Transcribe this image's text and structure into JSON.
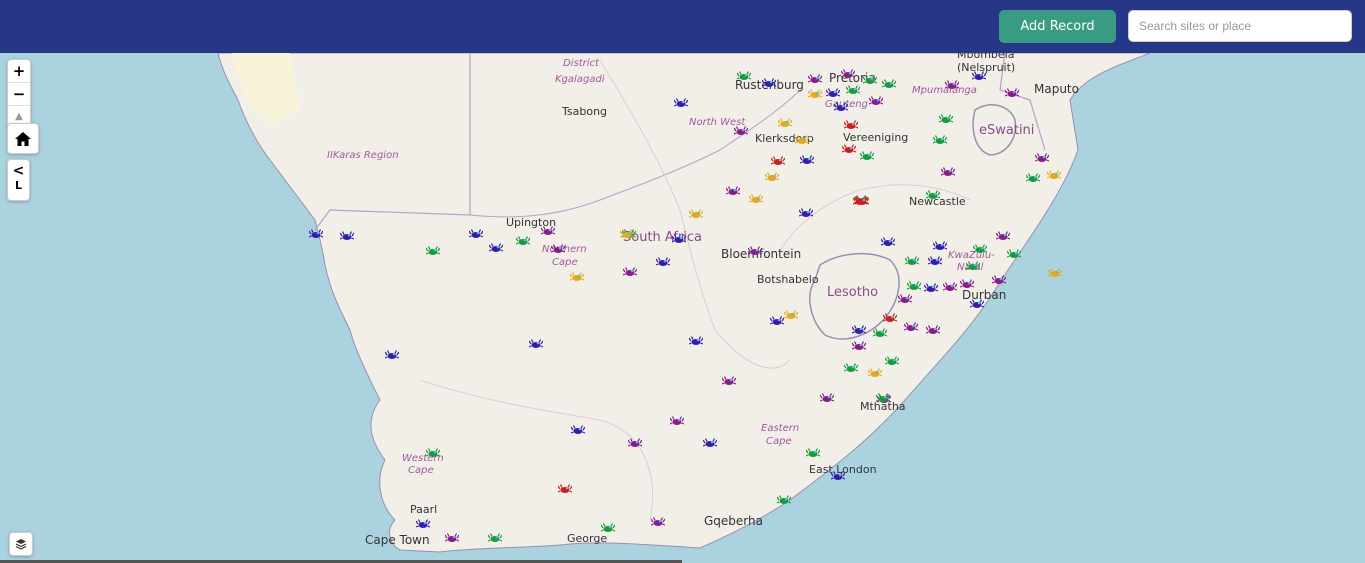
{
  "header": {
    "add_record_label": "Add Record",
    "search_placeholder": "Search sites or place"
  },
  "map_controls": {
    "zoom_in": "+",
    "zoom_out": "−",
    "reset_north": "▲",
    "side_panel_toggle": "<",
    "side_panel_letter": "L"
  },
  "colors": {
    "header": "#253785",
    "button": "#3a9b83",
    "water": "#aad3df",
    "land": "#f2efe9",
    "marker_green": "#1a9a3a",
    "marker_purple": "#8b1a8b",
    "marker_blue": "#3a1aa8",
    "marker_red": "#d21a1a",
    "marker_yellow": "#e8a817"
  },
  "map_labels": {
    "cities": [
      "Rustenburg",
      "Pretoria",
      "Mbombela (Nelspruit)",
      "Maputo",
      "Tsabong",
      "Klerksdorp",
      "Vereeniging",
      "Newcastle",
      "Upington",
      "Bloemfontein",
      "Botshabelo",
      "Durban",
      "Mthatha",
      "East London",
      "Gqeberha",
      "George",
      "Paarl",
      "Cape Town"
    ],
    "regions": [
      "Kgalagadi District",
      "North West",
      "Gauteng",
      "Mpumalanga",
      "IIKaras Region",
      "Northern Cape",
      "KwaZulu-Natal",
      "Eastern Cape",
      "Western Cape"
    ],
    "countries": [
      "eSwatini",
      "South Africa",
      "Lesotho"
    ]
  },
  "markers": [
    {
      "color": "green"
    },
    {
      "color": "blue"
    },
    {
      "color": "purple"
    },
    {
      "color": "purple"
    },
    {
      "color": "green"
    },
    {
      "color": "green"
    },
    {
      "color": "purple"
    },
    {
      "color": "green"
    },
    {
      "color": "blue"
    },
    {
      "color": "yellow"
    },
    {
      "color": "purple"
    },
    {
      "color": "blue"
    },
    {
      "color": "blue"
    },
    {
      "color": "green"
    },
    {
      "color": "purple"
    },
    {
      "color": "blue"
    },
    {
      "color": "yellow"
    },
    {
      "color": "purple"
    },
    {
      "color": "yellow"
    },
    {
      "color": "red"
    },
    {
      "color": "green"
    },
    {
      "color": "red"
    },
    {
      "color": "red"
    },
    {
      "color": "blue"
    },
    {
      "color": "green"
    },
    {
      "color": "yellow"
    },
    {
      "color": "purple"
    },
    {
      "color": "yellow"
    },
    {
      "color": "purple"
    },
    {
      "color": "green"
    },
    {
      "color": "green"
    },
    {
      "color": "purple"
    },
    {
      "color": "yellow"
    },
    {
      "color": "blue"
    },
    {
      "color": "green"
    },
    {
      "color": "blue"
    },
    {
      "color": "yellow"
    },
    {
      "color": "red"
    },
    {
      "color": "blue"
    },
    {
      "color": "blue"
    },
    {
      "color": "purple"
    },
    {
      "color": "blue"
    },
    {
      "color": "green"
    },
    {
      "color": "blue"
    },
    {
      "color": "green"
    },
    {
      "color": "purple"
    },
    {
      "color": "blue"
    },
    {
      "color": "red"
    },
    {
      "color": "green"
    },
    {
      "color": "purple"
    },
    {
      "color": "blue"
    },
    {
      "color": "yellow"
    },
    {
      "color": "purple"
    },
    {
      "color": "blue"
    },
    {
      "color": "blue"
    },
    {
      "color": "purple"
    },
    {
      "color": "purple"
    },
    {
      "color": "green"
    },
    {
      "color": "yellow"
    },
    {
      "color": "green"
    },
    {
      "color": "green"
    },
    {
      "color": "green"
    },
    {
      "color": "purple"
    },
    {
      "color": "blue"
    },
    {
      "color": "purple"
    },
    {
      "color": "blue"
    },
    {
      "color": "green"
    },
    {
      "color": "purple"
    },
    {
      "color": "blue"
    },
    {
      "color": "purple"
    },
    {
      "color": "green"
    },
    {
      "color": "purple"
    },
    {
      "color": "purple"
    },
    {
      "color": "green"
    },
    {
      "color": "red"
    },
    {
      "color": "green"
    },
    {
      "color": "purple"
    },
    {
      "color": "blue"
    },
    {
      "color": "blue"
    },
    {
      "color": "blue"
    },
    {
      "color": "blue"
    },
    {
      "color": "yellow"
    },
    {
      "color": "yellow"
    },
    {
      "color": "yellow"
    },
    {
      "color": "purple"
    },
    {
      "color": "green"
    },
    {
      "color": "blue"
    },
    {
      "color": "red"
    },
    {
      "color": "purple"
    },
    {
      "color": "blue"
    },
    {
      "color": "green"
    },
    {
      "color": "purple"
    },
    {
      "color": "purple"
    },
    {
      "color": "green"
    },
    {
      "color": "green"
    },
    {
      "color": "blue"
    },
    {
      "color": "blue"
    },
    {
      "color": "green"
    },
    {
      "color": "purple"
    },
    {
      "color": "green"
    },
    {
      "color": "purple"
    }
  ]
}
